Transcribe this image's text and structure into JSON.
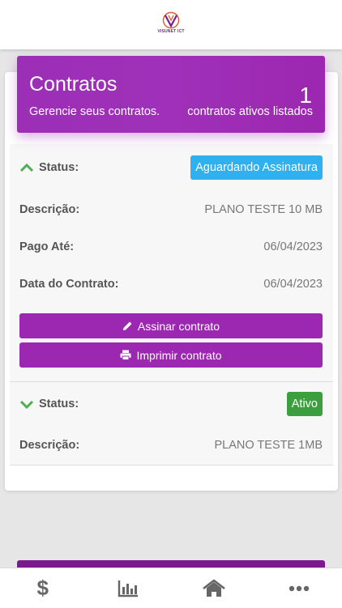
{
  "brand": {
    "logo_text": "VISUNET ICT"
  },
  "header": {
    "title": "Contratos",
    "subtitle": "Gerencie seus contratos.",
    "count": "1",
    "count_label": "contratos ativos listados"
  },
  "contracts": [
    {
      "expanded": true,
      "status_label": "Status:",
      "status": "Aguardando Assinatura",
      "status_color": "#2fb1ef",
      "fields": [
        {
          "label": "Descrição:",
          "value": "PLANO TESTE 10 MB"
        },
        {
          "label": "Pago Até:",
          "value": "06/04/2023"
        },
        {
          "label": "Data do Contrato:",
          "value": "06/04/2023"
        }
      ],
      "actions": [
        {
          "label": "Assinar contrato",
          "icon": "pencil-icon"
        },
        {
          "label": "Imprimir contrato",
          "icon": "printer-icon"
        }
      ]
    },
    {
      "expanded": false,
      "status_label": "Status:",
      "status": "Ativo",
      "status_color": "#3c9e3f",
      "fields": [
        {
          "label": "Descrição:",
          "value": "PLANO TESTE 1MB"
        }
      ]
    }
  ],
  "colors": {
    "primary": "#9c27b0",
    "chevron": "#4caf50"
  },
  "tabbar": [
    {
      "icon": "dollar-icon",
      "glyph": "$"
    },
    {
      "icon": "bar-chart-icon"
    },
    {
      "icon": "home-icon"
    },
    {
      "icon": "more-icon"
    }
  ]
}
